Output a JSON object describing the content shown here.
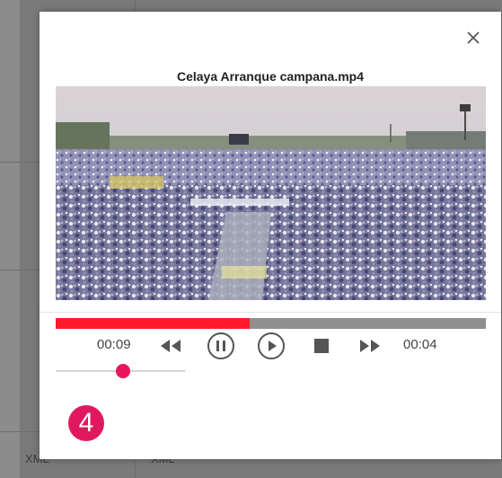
{
  "background": {
    "cells": [
      "XML",
      "XML"
    ]
  },
  "player": {
    "title": "Celaya Arranque campana.mp4",
    "elapsed": "00:09",
    "remaining": "00:04",
    "progress_fraction": 0.45,
    "volume_fraction": 0.52,
    "step_number": "4",
    "colors": {
      "progress_fill": "#ff1a2b",
      "progress_track": "#8f8f8f",
      "volume_thumb": "#e8175d",
      "badge": "#e0195f"
    },
    "icons": {
      "close": "close-icon",
      "rewind": "rewind-icon",
      "pause": "pause-icon",
      "play": "play-icon",
      "stop": "stop-icon",
      "forward": "fast-forward-icon"
    }
  }
}
